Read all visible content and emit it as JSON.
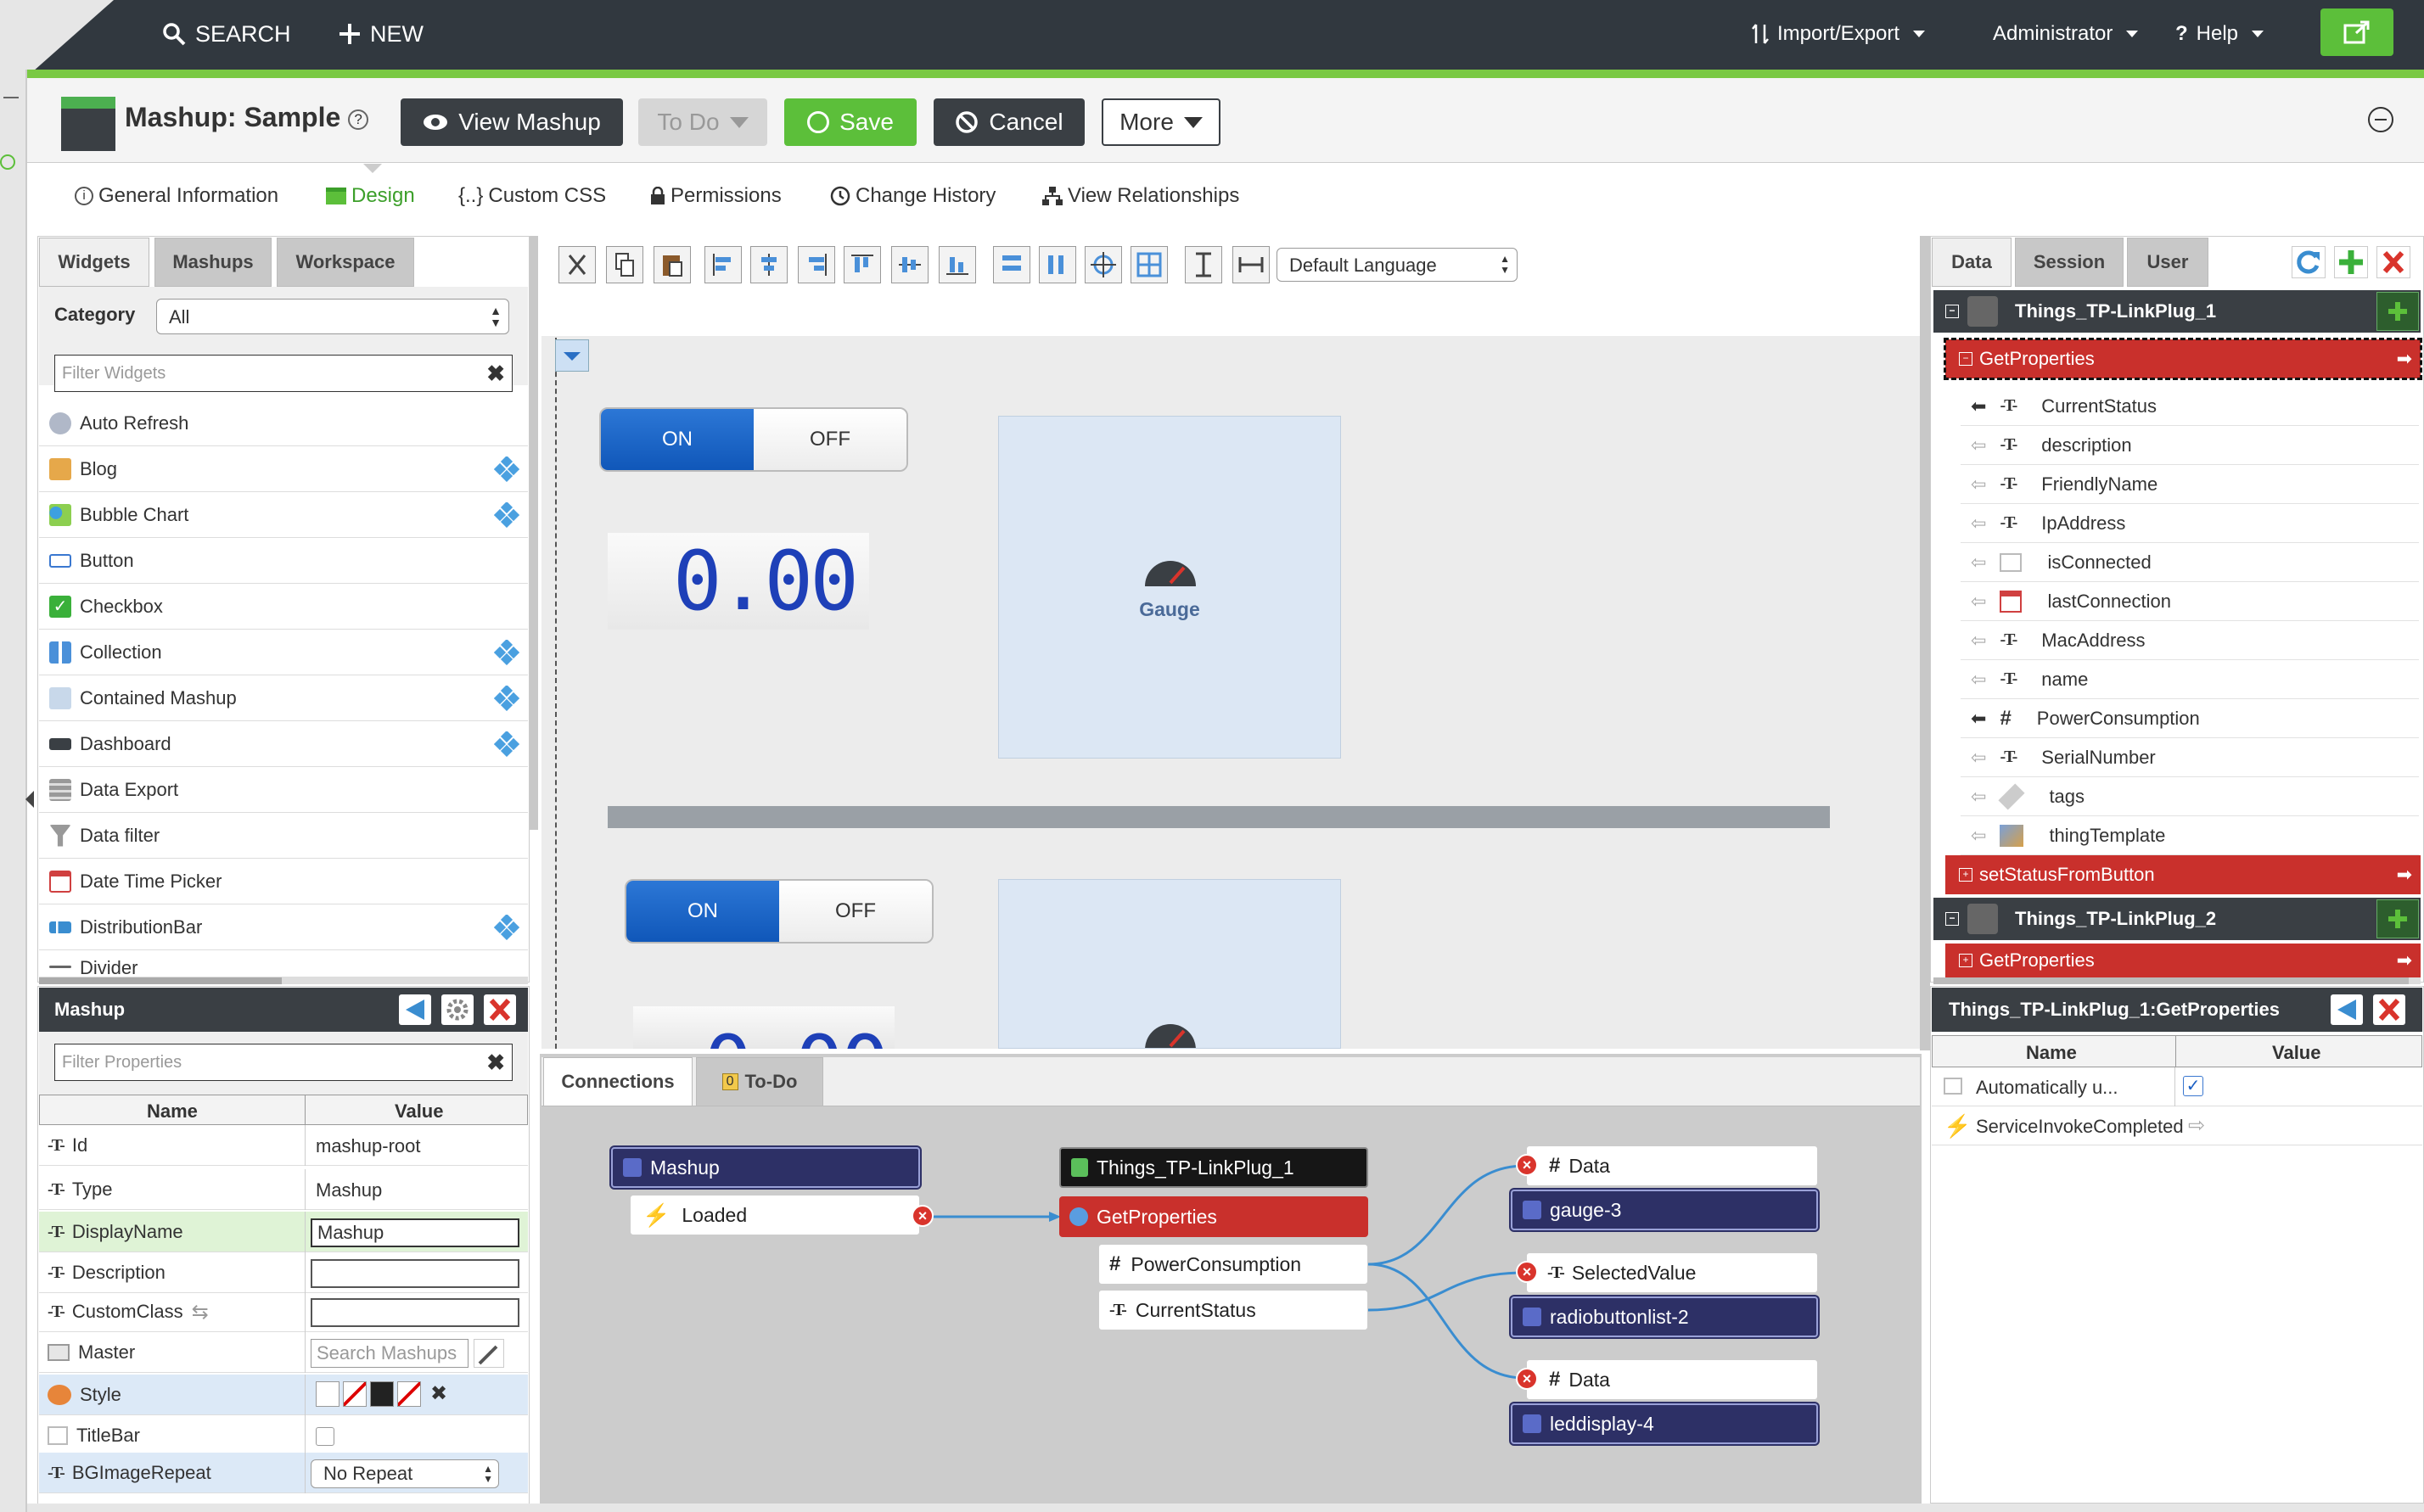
{
  "topbar": {
    "search_label": "SEARCH",
    "new_label": "NEW",
    "import_export_label": "Import/Export",
    "admin_label": "Administrator",
    "help_label": "Help"
  },
  "header": {
    "title": "Mashup: Sample",
    "view_mashup_label": "View Mashup",
    "todo_label": "To Do",
    "save_label": "Save",
    "cancel_label": "Cancel",
    "more_label": "More"
  },
  "main_tabs": {
    "general": "General Information",
    "design": "Design",
    "css": "Custom CSS",
    "permissions": "Permissions",
    "history": "Change History",
    "relationships": "View Relationships"
  },
  "widgets_panel": {
    "tabs": [
      "Widgets",
      "Mashups",
      "Workspace"
    ],
    "category_label": "Category",
    "category_value": "All",
    "filter_placeholder": "Filter Widgets",
    "items": [
      "Auto Refresh",
      "Blog",
      "Bubble Chart",
      "Button",
      "Checkbox",
      "Collection",
      "Contained Mashup",
      "Dashboard",
      "Data Export",
      "Data filter",
      "Date Time Picker",
      "DistributionBar",
      "Divider"
    ]
  },
  "properties_panel": {
    "title": "Mashup",
    "filter_placeholder": "Filter Properties",
    "col_name": "Name",
    "col_value": "Value",
    "rows": {
      "id": {
        "name": "Id",
        "value": "mashup-root"
      },
      "type": {
        "name": "Type",
        "value": "Mashup"
      },
      "display_name": {
        "name": "DisplayName",
        "value": "Mashup"
      },
      "description": {
        "name": "Description"
      },
      "custom_class": {
        "name": "CustomClass"
      },
      "master": {
        "name": "Master",
        "placeholder": "Search Mashups"
      },
      "style": {
        "name": "Style"
      },
      "titlebar": {
        "name": "TitleBar"
      },
      "bgimage": {
        "name": "BGImageRepeat",
        "value": "No Repeat"
      }
    }
  },
  "canvas": {
    "language": "Default Language",
    "toggle_on": "ON",
    "toggle_off": "OFF",
    "led_value": "0.00",
    "gauge_label": "Gauge"
  },
  "connections": {
    "tabs": [
      "Connections",
      "To-Do"
    ],
    "todo_count": "0",
    "nodes": {
      "mashup": "Mashup",
      "loaded": "Loaded",
      "thing1": "Things_TP-LinkPlug_1",
      "getprops": "GetProperties",
      "power": "PowerConsumption",
      "status": "CurrentStatus",
      "data1": "Data",
      "gauge": "gauge-3",
      "selected": "SelectedValue",
      "radio": "radiobuttonlist-2",
      "data2": "Data",
      "led": "leddisplay-4"
    }
  },
  "data_panel": {
    "tabs": [
      "Data",
      "Session",
      "User"
    ],
    "thing1": "Things_TP-LinkPlug_1",
    "service1": "GetProperties",
    "fields": [
      "CurrentStatus",
      "description",
      "FriendlyName",
      "IpAddress",
      "isConnected",
      "lastConnection",
      "MacAddress",
      "name",
      "PowerConsumption",
      "SerialNumber",
      "tags",
      "thingTemplate"
    ],
    "service2": "setStatusFromButton",
    "thing2": "Things_TP-LinkPlug_2",
    "service3": "GetProperties"
  },
  "service_props": {
    "title": "Things_TP-LinkPlug_1:GetProperties",
    "col_name": "Name",
    "col_value": "Value",
    "row1": "Automatically u...",
    "row2": "ServiceInvokeCompleted"
  },
  "colors": {
    "topbar": "#31383f",
    "accent_green": "#5cbf3a",
    "service_red": "#c9302c",
    "node_blue": "#2d3066"
  }
}
